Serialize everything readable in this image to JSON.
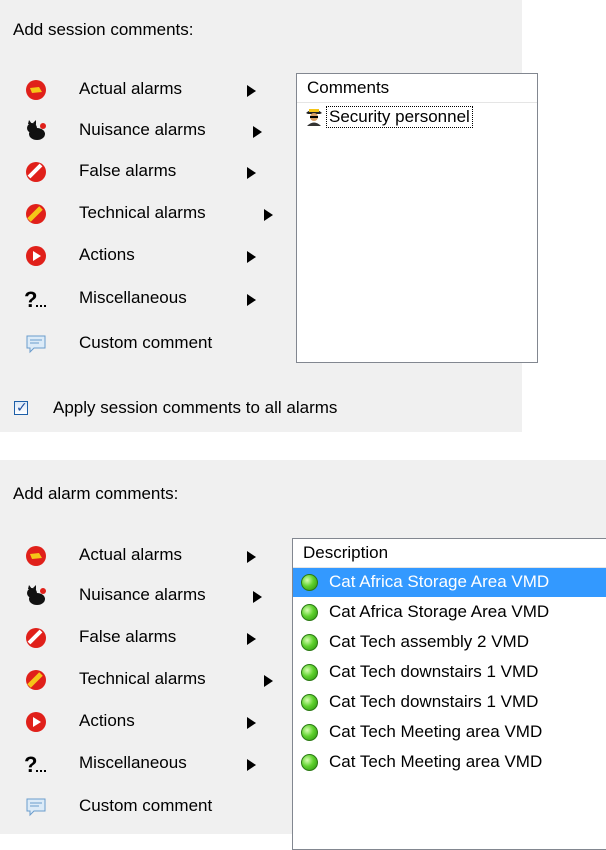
{
  "session": {
    "title": "Add session comments:",
    "menu": [
      {
        "label": "Actual alarms",
        "icon": "actual-alarm-icon",
        "submenu": true
      },
      {
        "label": "Nuisance alarms",
        "icon": "nuisance-cat-icon",
        "submenu": true
      },
      {
        "label": "False alarms",
        "icon": "false-alarm-icon",
        "submenu": true
      },
      {
        "label": "Technical alarms",
        "icon": "technical-alarm-icon",
        "submenu": true
      },
      {
        "label": "Actions",
        "icon": "actions-icon",
        "submenu": true
      },
      {
        "label": "Miscellaneous",
        "icon": "miscellaneous-icon",
        "submenu": true
      },
      {
        "label": "Custom comment",
        "icon": "custom-comment-icon",
        "submenu": false
      }
    ],
    "list_header": "Comments",
    "list_items": [
      {
        "label": "Security personnel",
        "icon": "security-personnel-icon"
      }
    ],
    "apply_all_label": "Apply session comments to all alarms",
    "apply_all_checked": true
  },
  "alarm": {
    "title": "Add alarm comments:",
    "menu": [
      {
        "label": "Actual alarms",
        "icon": "actual-alarm-icon",
        "submenu": true
      },
      {
        "label": "Nuisance alarms",
        "icon": "nuisance-cat-icon",
        "submenu": true
      },
      {
        "label": "False alarms",
        "icon": "false-alarm-icon",
        "submenu": true
      },
      {
        "label": "Technical alarms",
        "icon": "technical-alarm-icon",
        "submenu": true
      },
      {
        "label": "Actions",
        "icon": "actions-icon",
        "submenu": true
      },
      {
        "label": "Miscellaneous",
        "icon": "miscellaneous-icon",
        "submenu": true
      },
      {
        "label": "Custom comment",
        "icon": "custom-comment-icon",
        "submenu": false
      }
    ],
    "list_header": "Description",
    "list_items": [
      {
        "label": "Cat Africa Storage Area VMD",
        "selected": true
      },
      {
        "label": "Cat Africa Storage Area VMD",
        "selected": false
      },
      {
        "label": "Cat Tech assembly 2 VMD",
        "selected": false
      },
      {
        "label": "Cat Tech downstairs 1 VMD",
        "selected": false
      },
      {
        "label": "Cat Tech downstairs 1 VMD",
        "selected": false
      },
      {
        "label": "Cat Tech Meeting area VMD",
        "selected": false
      },
      {
        "label": "Cat Tech Meeting area VMD",
        "selected": false
      }
    ]
  },
  "colors": {
    "panel_bg": "#f0f0f0",
    "selection": "#3399ff",
    "status_green": "#5fd12e",
    "alarm_red": "#e0201a"
  }
}
